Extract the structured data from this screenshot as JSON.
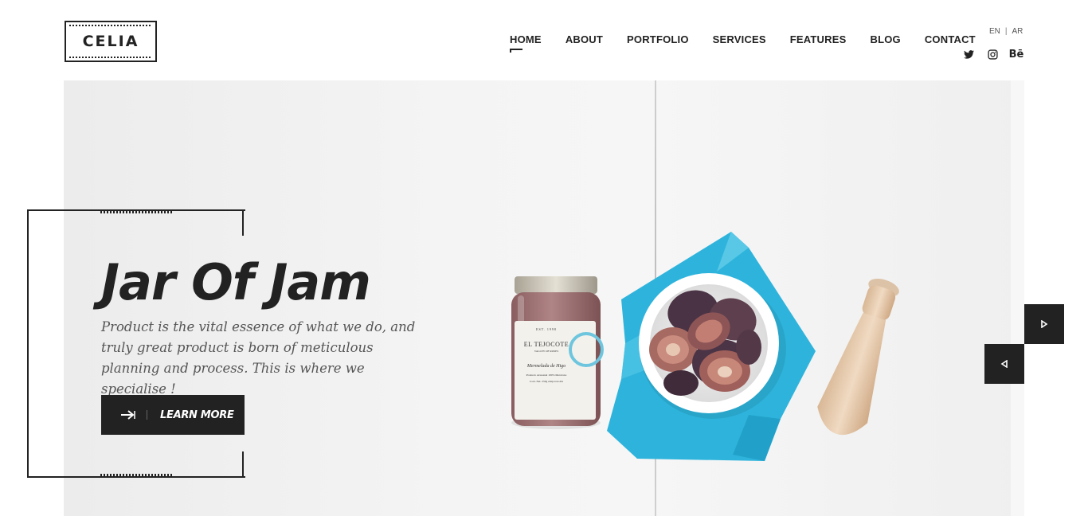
{
  "header": {
    "logo_text": "CELIA",
    "nav": [
      "HOME",
      "ABOUT",
      "PORTFOLIO",
      "SERVICES",
      "FEATURES",
      "BLOG",
      "CONTACT"
    ],
    "active_nav": "HOME",
    "languages": [
      "EN",
      "AR"
    ],
    "language_separator": "|",
    "social_icons": [
      "twitter-icon",
      "instagram-icon",
      "behance-icon"
    ],
    "behance_text": "Bē"
  },
  "hero": {
    "title": "Jar Of Jam",
    "description": "Product is the vital essence of what we do, and truly great product is born of meticulous planning and process. This is where we specialise !",
    "cta_label": "LEARN MORE",
    "jar_label_brand": "EL TEJOCOTE",
    "jar_label_top": "EST. 1998",
    "jar_label_sub": "VALLEY OF ROSES",
    "jar_label_script": "Mermelada de Higo",
    "jar_label_line1": "Producto Artesanal 100% Mexicano",
    "jar_label_line2": "Cont. Net. 250g  eltejocote.mx"
  },
  "colors": {
    "dark": "#222222",
    "background": "#ffffff",
    "hero_bg": "#f2f2f2",
    "napkin": "#2eb4dc",
    "fig": "#5a3b4a"
  }
}
